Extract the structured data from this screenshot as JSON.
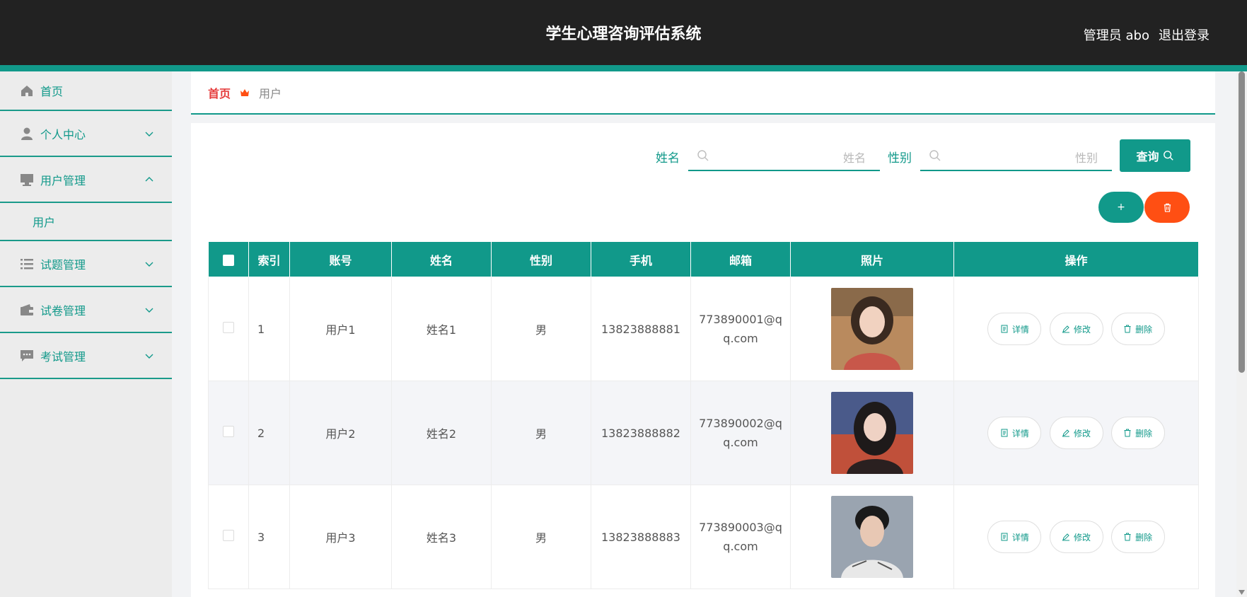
{
  "header": {
    "title": "学生心理咨询评估系统",
    "user": "管理员 abo",
    "logout": "退出登录"
  },
  "sidebar": {
    "items": [
      {
        "label": "首页",
        "icon": "home-icon"
      },
      {
        "label": "个人中心",
        "icon": "person-icon",
        "expanded": false
      },
      {
        "label": "用户管理",
        "icon": "monitor-icon",
        "expanded": true,
        "children": [
          "用户"
        ]
      },
      {
        "label": "试题管理",
        "icon": "list-icon",
        "expanded": false
      },
      {
        "label": "试卷管理",
        "icon": "wallet-icon",
        "expanded": false
      },
      {
        "label": "考试管理",
        "icon": "chat-icon",
        "expanded": false
      }
    ]
  },
  "breadcrumb": {
    "home": "首页",
    "current": "用户"
  },
  "search": {
    "name_label": "姓名",
    "name_placeholder": "姓名",
    "gender_label": "性别",
    "gender_placeholder": "性别",
    "query_button": "查询"
  },
  "actions": {
    "add": "+",
    "delete_icon": "trash-icon"
  },
  "table": {
    "headers": [
      "",
      "索引",
      "账号",
      "姓名",
      "性别",
      "手机",
      "邮箱",
      "照片",
      "操作"
    ],
    "rows": [
      {
        "index": "1",
        "account": "用户1",
        "name": "姓名1",
        "gender": "男",
        "phone": "13823888881",
        "email": "773890001@qq.com"
      },
      {
        "index": "2",
        "account": "用户2",
        "name": "姓名2",
        "gender": "男",
        "phone": "13823888882",
        "email": "773890002@qq.com"
      },
      {
        "index": "3",
        "account": "用户3",
        "name": "姓名3",
        "gender": "男",
        "phone": "13823888883",
        "email": "773890003@qq.com"
      }
    ],
    "ops": {
      "detail": "详情",
      "edit": "修改",
      "delete": "删除"
    }
  },
  "colors": {
    "accent": "#11998a",
    "danger": "#ff4f13",
    "header_bg": "#222222",
    "breadcrumb_home": "#e53c3c"
  }
}
